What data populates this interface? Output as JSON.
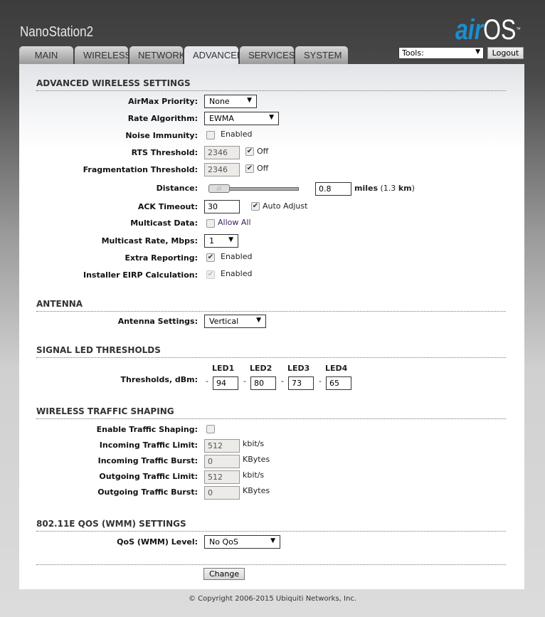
{
  "header": {
    "device_name": "NanoStation2",
    "logo": "airOS",
    "logo_air": "air",
    "logo_os": "OS",
    "logo_tm": "™",
    "tabs": [
      "MAIN",
      "WIRELESS",
      "NETWORK",
      "ADVANCED",
      "SERVICES",
      "SYSTEM"
    ],
    "active_tab": "ADVANCED",
    "tools_select": "Tools:",
    "logout": "Logout"
  },
  "advanced": {
    "title": "ADVANCED WIRELESS SETTINGS",
    "airmax_label": "AirMax Priority:",
    "airmax_value": "None",
    "rate_label": "Rate Algorithm:",
    "rate_value": "EWMA",
    "noise_label": "Noise Immunity:",
    "noise_text": "Enabled",
    "noise_checked": false,
    "rts_label": "RTS Threshold:",
    "rts_value": "2346",
    "rts_off": "Off",
    "rts_checked": true,
    "frag_label": "Fragmentation Threshold:",
    "frag_value": "2346",
    "frag_off": "Off",
    "frag_checked": true,
    "distance_label": "Distance:",
    "distance_value": "0.8",
    "distance_unit": "miles",
    "distance_km_open": "(1.3 ",
    "distance_km_unit": "km",
    "distance_km_close": ")",
    "ack_label": "ACK Timeout:",
    "ack_value": "30",
    "ack_auto": "Auto Adjust",
    "ack_checked": true,
    "mcast_label": "Multicast Data:",
    "mcast_text": "Allow All",
    "mcast_checked": false,
    "mrate_label": "Multicast Rate, Mbps:",
    "mrate_value": "1",
    "extra_label": "Extra Reporting:",
    "extra_text": "Enabled",
    "extra_checked": true,
    "eirp_label": "Installer EIRP Calculation:",
    "eirp_text": "Enabled",
    "eirp_checked": true
  },
  "antenna": {
    "title": "ANTENNA",
    "label": "Antenna Settings:",
    "value": "Vertical"
  },
  "led": {
    "title": "SIGNAL LED THRESHOLDS",
    "label": "Thresholds, dBm:",
    "dash": "-",
    "leds": [
      {
        "name": "LED1",
        "value": "94"
      },
      {
        "name": "LED2",
        "value": "80"
      },
      {
        "name": "LED3",
        "value": "73"
      },
      {
        "name": "LED4",
        "value": "65"
      }
    ]
  },
  "shaping": {
    "title": "WIRELESS TRAFFIC SHAPING",
    "enable_label": "Enable Traffic Shaping:",
    "enable_checked": false,
    "in_limit_label": "Incoming Traffic Limit:",
    "in_limit_value": "512",
    "in_limit_unit": "kbit/s",
    "in_burst_label": "Incoming Traffic Burst:",
    "in_burst_value": "0",
    "in_burst_unit": "KBytes",
    "out_limit_label": "Outgoing Traffic Limit:",
    "out_limit_value": "512",
    "out_limit_unit": "kbit/s",
    "out_burst_label": "Outgoing Traffic Burst:",
    "out_burst_value": "0",
    "out_burst_unit": "KBytes"
  },
  "qos": {
    "title": "802.11E QOS (WMM) SETTINGS",
    "label": "QoS (WMM) Level:",
    "value": "No QoS"
  },
  "change": "Change",
  "footer": "© Copyright 2006-2015 Ubiquiti Networks, Inc."
}
